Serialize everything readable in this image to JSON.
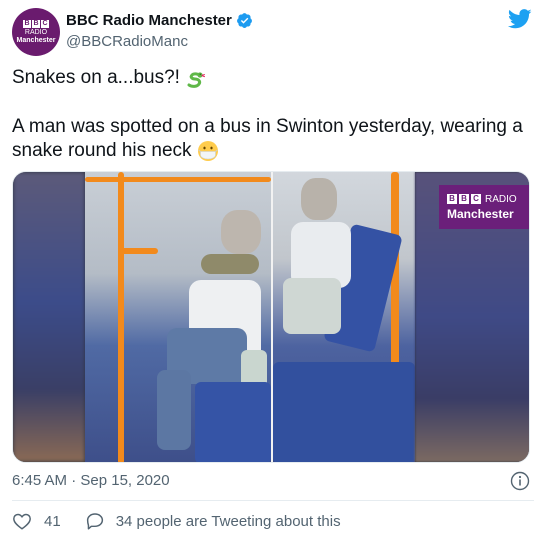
{
  "account": {
    "display_name": "BBC Radio Manchester",
    "handle": "@BBCRadioManc",
    "avatar": {
      "bbc": [
        "B",
        "B",
        "C"
      ],
      "line1": "RADIO",
      "line2": "Manchester"
    }
  },
  "tweet": {
    "line1": "Snakes on a...bus?! ",
    "line1_emoji": "snake-icon",
    "line2": "A man was spotted on a bus in Swinton yesterday, wearing a snake round his neck ",
    "line2_emoji": "face-mask-icon"
  },
  "media": {
    "logo_bbc": [
      "B",
      "B",
      "C"
    ],
    "logo_radio": "RADIO",
    "logo_city": "Manchester"
  },
  "meta": {
    "timestamp": "6:45 AM · Sep 15, 2020"
  },
  "actions": {
    "likes": "41",
    "replies_text": "34 people are Tweeting about this"
  },
  "colors": {
    "brand_purple": "#6a1b6e",
    "verified_blue": "#1d9bf0",
    "twitter_blue": "#1da1f2",
    "muted": "#536471"
  }
}
